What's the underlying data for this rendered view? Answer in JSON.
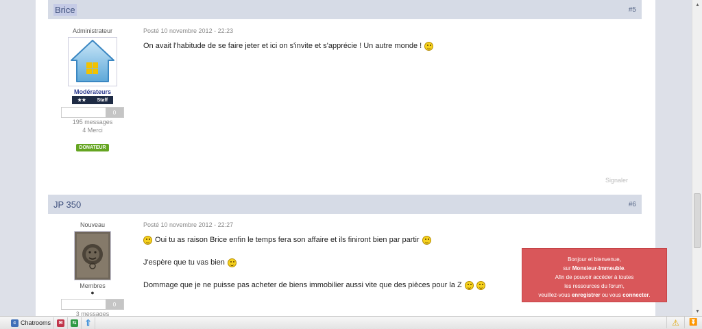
{
  "posts": [
    {
      "author": "Brice",
      "number": "#5",
      "rank": "Administrateur",
      "group": "Modérateurs",
      "badge": {
        "stars": "★★",
        "label": "Staff"
      },
      "reputation": "0",
      "messages": "195 messages",
      "merci": "4 Merci",
      "donateur": "DONATEUR",
      "date": "Posté 10 novembre 2012 - 22:23",
      "lines": [
        "On avait l'habitude de se faire jeter et ici on s'invite et s'apprécie !  Un autre monde !"
      ],
      "signaler": "Signaler"
    },
    {
      "author": "JP 350",
      "number": "#6",
      "rank": "Nouveau",
      "group": "Membres",
      "reputation": "0",
      "messages": "3 messages",
      "date": "Posté 10 novembre 2012 - 22:27",
      "lines": [
        "Oui tu as raison Brice enfin le temps fera son affaire et ils finiront bien par partir",
        "J'espère que tu vas bien",
        "Dommage que je ne puisse pas acheter de biens immobilier aussi vite que des pièces pour la Z"
      ]
    }
  ],
  "popup": {
    "line1": "Bonjour et bienvenue,",
    "line2_pre": "sur ",
    "site": "Monsieur-Immeuble",
    "line2_post": ".",
    "line3": "Afin de pouvoir accéder à toutes",
    "line4": "les ressources du forum,",
    "line5_pre": "veuillez-vous ",
    "register": "enregistrer",
    "line5_mid": " ou vous ",
    "login": "connecter",
    "line5_post": "."
  },
  "bottombar": {
    "chatrooms": "Chatrooms"
  },
  "colors": {
    "header_bg": "#d6dbe6",
    "popup_bg": "#d9575a",
    "donateur_bg": "#65a521",
    "staff_bg": "#1e2b44"
  }
}
